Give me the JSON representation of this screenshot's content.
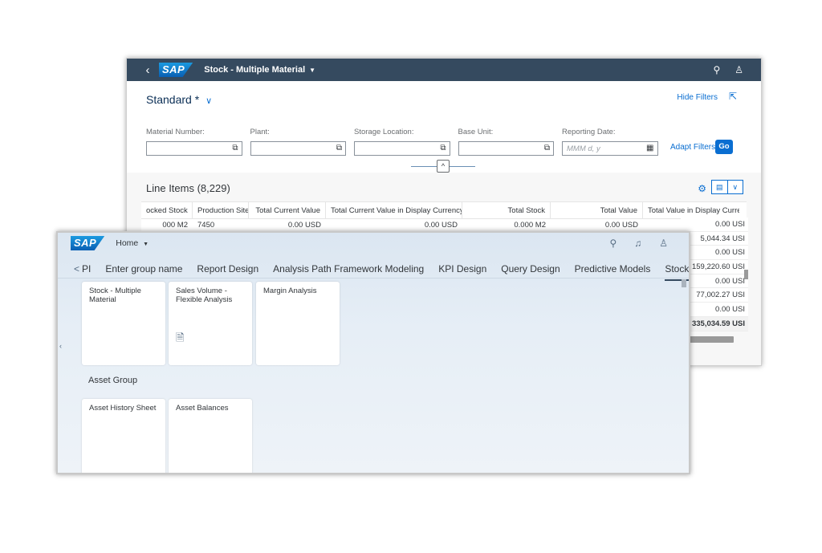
{
  "back_window": {
    "shellbar": {
      "back_glyph": "‹",
      "logo": "SAP",
      "title": "Stock - Multiple Material",
      "caret": "▼",
      "search_glyph": "⚲",
      "user_glyph": "♙"
    },
    "variant": {
      "name": "Standard *",
      "chevron": "∨"
    },
    "hide_filters": "Hide Filters",
    "share_glyph": "⇱",
    "filters": [
      {
        "label": "Material Number:",
        "value": "",
        "placeholder": ""
      },
      {
        "label": "Plant:",
        "value": "",
        "placeholder": ""
      },
      {
        "label": "Storage Location:",
        "value": "",
        "placeholder": ""
      },
      {
        "label": "Base Unit:",
        "value": "",
        "placeholder": ""
      },
      {
        "label": "Reporting Date:",
        "value": "",
        "placeholder": "MMM d, y"
      }
    ],
    "value_help_glyph": "⧉",
    "calendar_glyph": "▦",
    "adapt_filters": "Adapt Filters",
    "go": "Go",
    "collapse_glyph": "^",
    "table": {
      "title": "Line Items (8,229)",
      "gear_glyph": "⚙",
      "view_glyph": "▤",
      "view_caret": "∨",
      "columns": [
        "ocked Stock",
        "Production Site",
        "Total Current Value",
        "Total Current Value in Display Currency",
        "Total Stock",
        "Total Value",
        "Total Value in Display Curren"
      ],
      "first_row": [
        "000  M2",
        "7450",
        "0.00  USD",
        "0.00  USD",
        "0.000  M2",
        "0.00  USD",
        ""
      ],
      "right_column_values": [
        "0.00  USI",
        "5,044.34  USI",
        "0.00  USI",
        "159,220.60  USI",
        "0.00  USI",
        "77,002.27  USI",
        "0.00  USI",
        "335,034.59  USI"
      ]
    }
  },
  "front_window": {
    "logo": "SAP",
    "home": "Home",
    "caret": "▼",
    "search_glyph": "⚲",
    "bell_glyph": "♫",
    "user_glyph": "♙",
    "tabs": {
      "prev_glyph": "<",
      "items": [
        "PI",
        "Enter group name",
        "Report Design",
        "Analysis Path Framework Modeling",
        "KPI Design",
        "Query Design",
        "Predictive Models",
        "Stock"
      ],
      "next_glyph": ">",
      "overflow_glyph": "∨"
    },
    "tiles": [
      "Stock - Multiple Material",
      "Sales Volume - Flexible Analysis",
      "Margin Analysis"
    ],
    "tile_doc_glyph": "🗎",
    "group_title": "Asset Group",
    "group_tiles": [
      "Asset History Sheet",
      "Asset Balances"
    ],
    "edge_glyph": "‹"
  }
}
